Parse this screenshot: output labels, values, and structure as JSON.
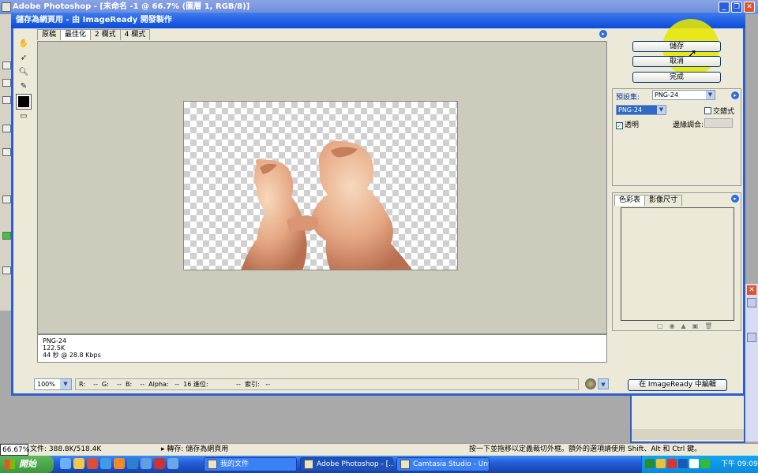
{
  "ps_app": {
    "title": "Adobe Photoshop - [未命名 -1 @ 66.7% (圖層 1, RGB/8)]"
  },
  "dialog": {
    "title": "儲存為網頁用 - 由 ImageReady 開發製作",
    "tabs": [
      {
        "label": "原稿",
        "active": false
      },
      {
        "label": "最佳化",
        "active": true
      },
      {
        "label": "2 欄式",
        "active": false
      },
      {
        "label": "4 欄式",
        "active": false
      }
    ],
    "tools": [
      "hand-icon",
      "slice-select-icon",
      "zoom-icon",
      "eyedropper-icon",
      "eyedropper-color-swatch",
      "toggle-slices-icon"
    ],
    "preview_info": {
      "format": "PNG-24",
      "size": "122.5K",
      "time": "44 秒 @ 28.8 Kbps"
    },
    "status": {
      "zoom": "100%",
      "readout": "R:    --  G:    --  B:    --  Alpha:   --  16 進位:              --  索引:   --"
    },
    "buttons": {
      "save": "儲存",
      "cancel": "取消",
      "done": "完成",
      "edit_in_imageready": "在 ImageReady 中編輯"
    },
    "settings": {
      "preset_label": "預設集:",
      "preset_value": "PNG-24",
      "format_value": "PNG-24",
      "interlace_label": "交錯式",
      "interlace_checked": false,
      "transparency_label": "透明",
      "transparency_checked": true,
      "matte_label": "邊緣調合:"
    },
    "color_panel": {
      "tabs": [
        "色彩表",
        "影像尺寸"
      ]
    }
  },
  "ps_status": {
    "zoom": "66.67%",
    "doc_info": "文件: 388.8K/518.4K",
    "hint_left": "轉存: 儲存為網頁用",
    "hint_right": "按一下並拖移以定義裁切外框。額外的選項請使用 Shift、Alt 和 Ctrl 鍵。"
  },
  "taskbar": {
    "start_label": "開始",
    "tasks": [
      {
        "label": "我的文件",
        "active": false
      },
      {
        "label": "Adobe Photoshop - [...",
        "active": true
      },
      {
        "label": "Camtasia Studio - Unti...",
        "active": false
      }
    ],
    "clock": "下午 09:09"
  },
  "colors": {
    "xp_blue": "#0a4cd8",
    "highlight": "#e6e600",
    "start_green": "#3c963c"
  }
}
